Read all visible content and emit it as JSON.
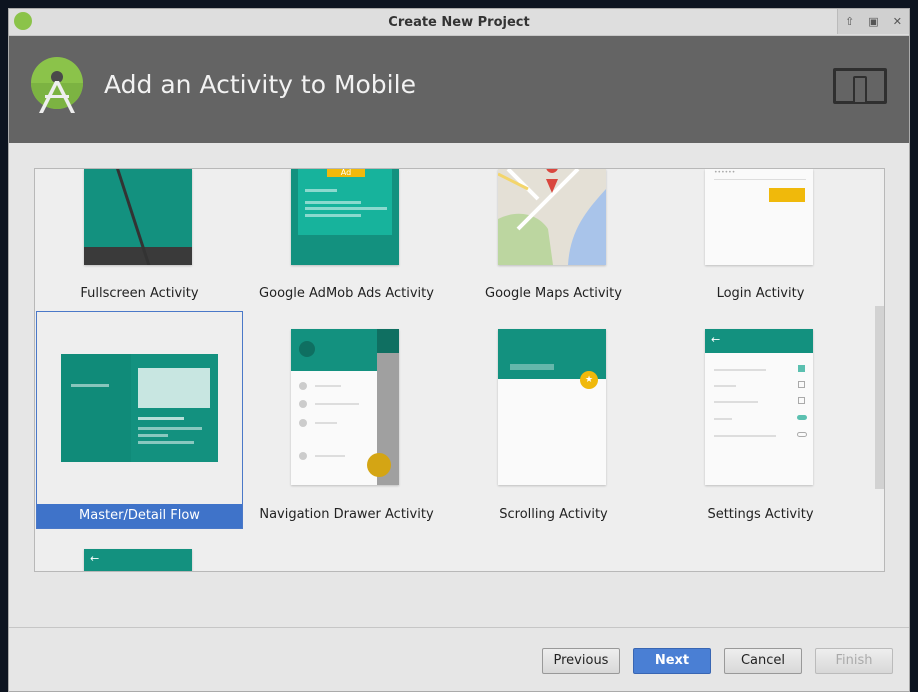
{
  "window": {
    "title": "Create New Project"
  },
  "header": {
    "title": "Add an Activity to Mobile"
  },
  "activities": [
    {
      "label": "Fullscreen Activity"
    },
    {
      "label": "Google AdMob Ads Activity"
    },
    {
      "label": "Google Maps Activity"
    },
    {
      "label": "Login Activity"
    },
    {
      "label": "Master/Detail Flow",
      "selected": true
    },
    {
      "label": "Navigation Drawer Activity"
    },
    {
      "label": "Scrolling Activity"
    },
    {
      "label": "Settings Activity"
    }
  ],
  "admob": {
    "badge": "Ad"
  },
  "login": {
    "password": "••••••"
  },
  "buttons": {
    "previous": "Previous",
    "next": "Next",
    "cancel": "Cancel",
    "finish": "Finish"
  },
  "colors": {
    "accent": "#3f73c9",
    "teal": "#13917f",
    "header": "#646464"
  }
}
